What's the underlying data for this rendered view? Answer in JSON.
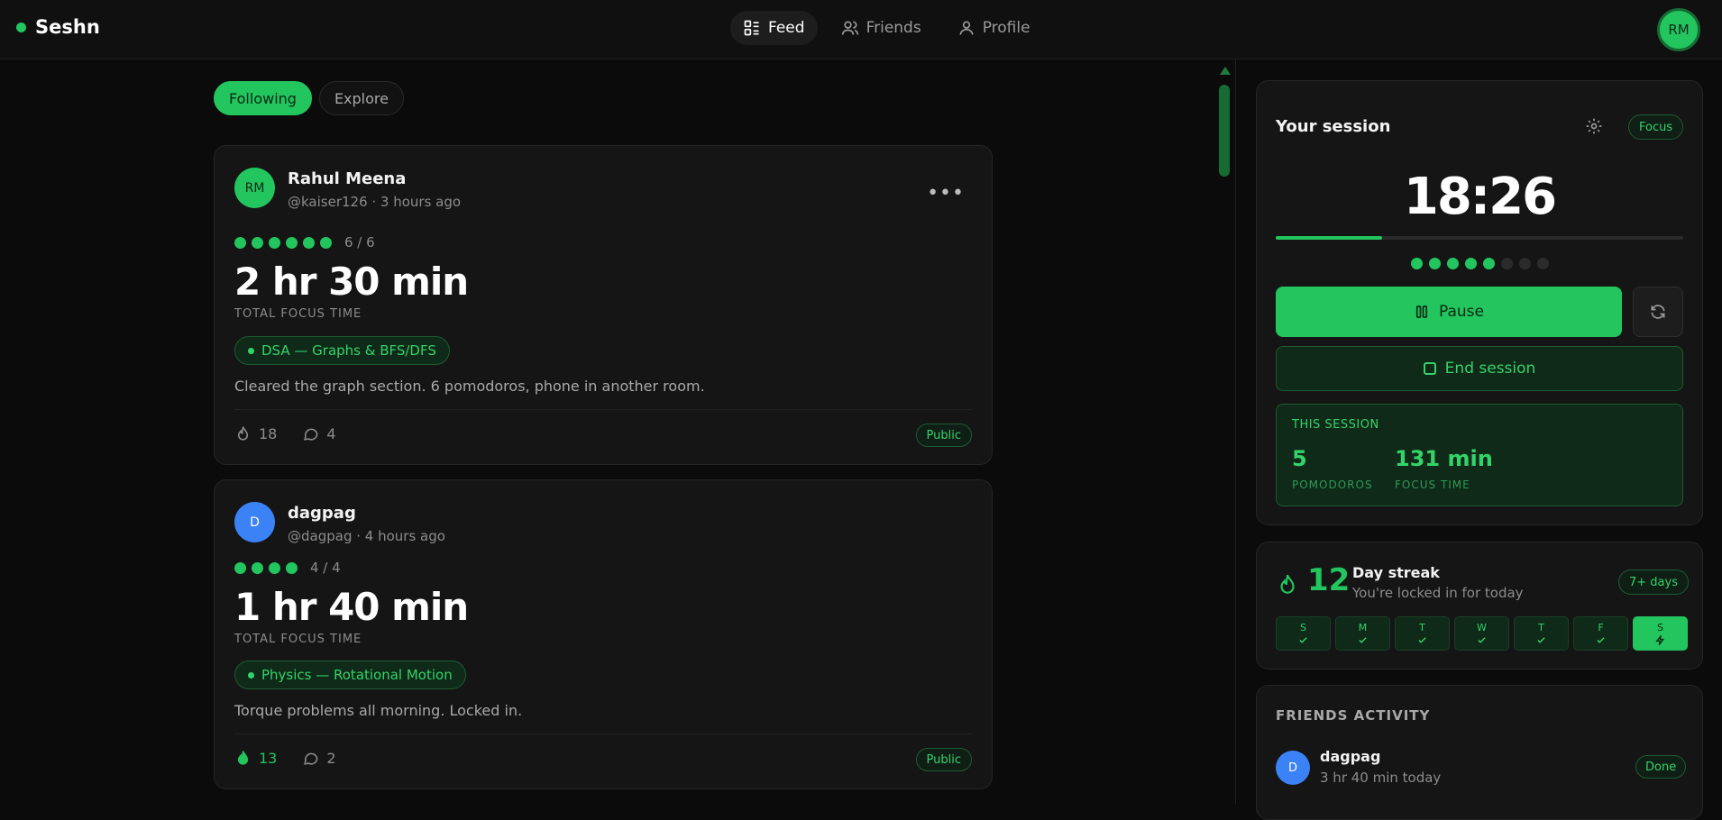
{
  "app": {
    "brand": "Seshn",
    "user_initials": "RM"
  },
  "nav": {
    "feed": "Feed",
    "friends": "Friends",
    "profile": "Profile"
  },
  "feed_filter": {
    "following": "Following",
    "explore": "Explore"
  },
  "posts": [
    {
      "initials": "RM",
      "avatar_color": "#22c55e",
      "avatar_text_color": "#0d2a18",
      "name": "Rahul Meena",
      "meta": "@kaiser126 · 3 hours ago",
      "pomodoros": 6,
      "pomodoro_label": "6 / 6",
      "duration": "2 hr 30 min",
      "duration_label": "TOTAL FOCUS TIME",
      "tag": "DSA — Graphs & BFS/DFS",
      "note": "Cleared the graph section. 6 pomodoros, phone in another room.",
      "fires": "18",
      "comments": "4",
      "fire_active": false,
      "visibility": "Public"
    },
    {
      "initials": "D",
      "avatar_color": "#3b82f6",
      "avatar_text_color": "#ffffff",
      "name": "dagpag",
      "meta": "@dagpag · 4 hours ago",
      "pomodoros": 4,
      "pomodoro_label": "4 / 4",
      "duration": "1 hr 40 min",
      "duration_label": "TOTAL FOCUS TIME",
      "tag": "Physics — Rotational Motion",
      "note": "Torque problems all morning. Locked in.",
      "fires": "13",
      "comments": "2",
      "fire_active": true,
      "visibility": "Public"
    }
  ],
  "session": {
    "title": "Your session",
    "mode": "Focus",
    "timer": "18:26",
    "progress_fraction": 0.26,
    "pomodoros_done": 5,
    "pomodoros_total": 8,
    "pause_label": "Pause",
    "end_label": "End session",
    "stats_title": "THIS SESSION",
    "pomodoros_value": "5",
    "pomodoros_label": "POMODOROS",
    "focus_value": "131 min",
    "focus_label": "FOCUS TIME"
  },
  "streak": {
    "count": "12",
    "title": "Day streak",
    "subtitle": "You're locked in for today",
    "badge": "7+ days",
    "days": [
      {
        "label": "S",
        "state": "done"
      },
      {
        "label": "M",
        "state": "done"
      },
      {
        "label": "T",
        "state": "done"
      },
      {
        "label": "W",
        "state": "done"
      },
      {
        "label": "T",
        "state": "done"
      },
      {
        "label": "F",
        "state": "done"
      },
      {
        "label": "S",
        "state": "today"
      }
    ]
  },
  "friends_activity": {
    "title": "FRIENDS ACTIVITY",
    "items": [
      {
        "initials": "D",
        "name": "dagpag",
        "sub": "3 hr 40 min today",
        "status": "Done"
      }
    ]
  },
  "colors": {
    "accent": "#22c55e",
    "background": "#0b0b0b",
    "card": "#151515"
  }
}
